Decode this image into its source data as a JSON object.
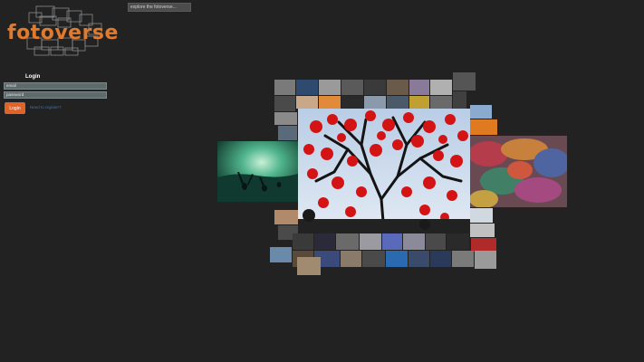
{
  "logo": {
    "text": "fotoverse"
  },
  "search": {
    "placeholder": "explore the fotoverse..."
  },
  "login": {
    "title": "Login",
    "email_placeholder": "email",
    "password_placeholder": "password",
    "button_label": "Login",
    "register_link": "Need to register?"
  },
  "colors": {
    "background": "#222222",
    "brand_orange": "#e07a2e",
    "button": "#e0642a",
    "link": "#3b73a8",
    "field_bg": "#5e6a6c"
  },
  "icons": [
    "logo-frames-icon"
  ]
}
